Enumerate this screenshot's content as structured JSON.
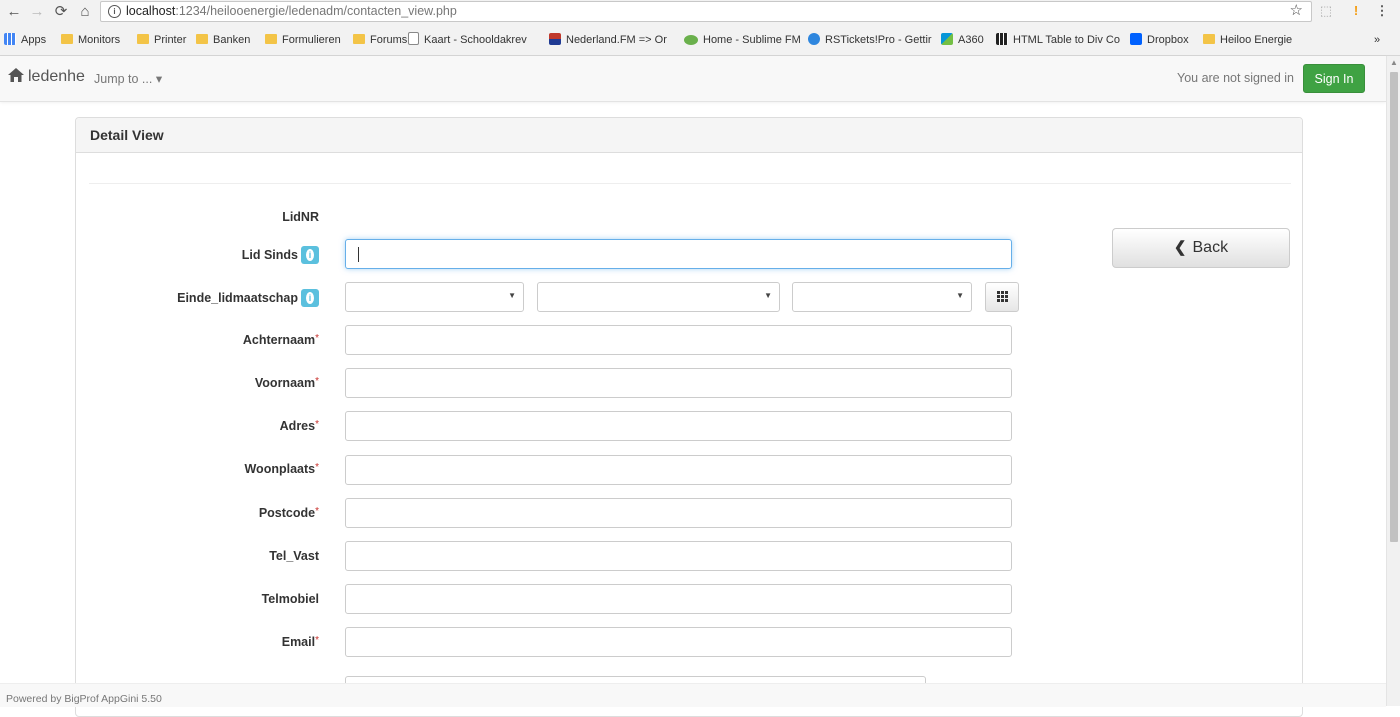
{
  "browser": {
    "url_host": "localhost",
    "url_rest": ":1234/heilooenergie/ledenadm/contacten_view.php",
    "bookmarks": [
      {
        "label": "Apps",
        "icon": "apps-grid-icon"
      },
      {
        "label": "Monitors",
        "icon": "folder-icon"
      },
      {
        "label": "Printer",
        "icon": "folder-icon"
      },
      {
        "label": "Banken",
        "icon": "folder-icon"
      },
      {
        "label": "Formulieren",
        "icon": "folder-icon"
      },
      {
        "label": "Forums",
        "icon": "folder-icon"
      },
      {
        "label": "Kaart - Schooldakrev",
        "icon": "page-icon"
      },
      {
        "label": "Nederland.FM => Or",
        "icon": "fm-icon"
      },
      {
        "label": "Home - Sublime FM",
        "icon": "sublime-icon"
      },
      {
        "label": "RSTickets!Pro - Gettir",
        "icon": "rs-icon"
      },
      {
        "label": "A360",
        "icon": "a360-icon"
      },
      {
        "label": "HTML Table to Div Co",
        "icon": "grid-icon"
      },
      {
        "label": "Dropbox",
        "icon": "dropbox-icon"
      },
      {
        "label": "Heiloo Energie",
        "icon": "folder-icon"
      }
    ],
    "more_label": "»"
  },
  "navbar": {
    "brand": "ledenhe",
    "jump_to": "Jump to ... ▾",
    "not_signed_in": "You are not signed in",
    "sign_in": "Sign In"
  },
  "panel": {
    "title": "Detail View",
    "back_label": "Back"
  },
  "fields": [
    {
      "label": "LidNR",
      "required": false,
      "help": false,
      "type": "static",
      "value": ""
    },
    {
      "label": "Lid Sinds",
      "required": false,
      "help": true,
      "type": "text",
      "value": ""
    },
    {
      "label": "Einde_lidmaatschap",
      "required": false,
      "help": true,
      "type": "date",
      "value": ""
    },
    {
      "label": "Achternaam",
      "required": true,
      "help": false,
      "type": "text",
      "value": ""
    },
    {
      "label": "Voornaam",
      "required": true,
      "help": false,
      "type": "text",
      "value": ""
    },
    {
      "label": "Adres",
      "required": true,
      "help": false,
      "type": "text",
      "value": ""
    },
    {
      "label": "Woonplaats",
      "required": true,
      "help": false,
      "type": "text",
      "value": ""
    },
    {
      "label": "Postcode",
      "required": true,
      "help": false,
      "type": "text",
      "value": ""
    },
    {
      "label": "Tel_Vast",
      "required": false,
      "help": false,
      "type": "text",
      "value": ""
    },
    {
      "label": "Telmobiel",
      "required": false,
      "help": false,
      "type": "text",
      "value": ""
    },
    {
      "label": "Email",
      "required": true,
      "help": false,
      "type": "text",
      "value": ""
    }
  ],
  "required_mark": "*",
  "footer": "Powered by BigProf AppGini 5.50",
  "colors": {
    "accent_success": "#3fa243",
    "info_badge": "#5bc0de",
    "focus_border": "#66afe9"
  }
}
